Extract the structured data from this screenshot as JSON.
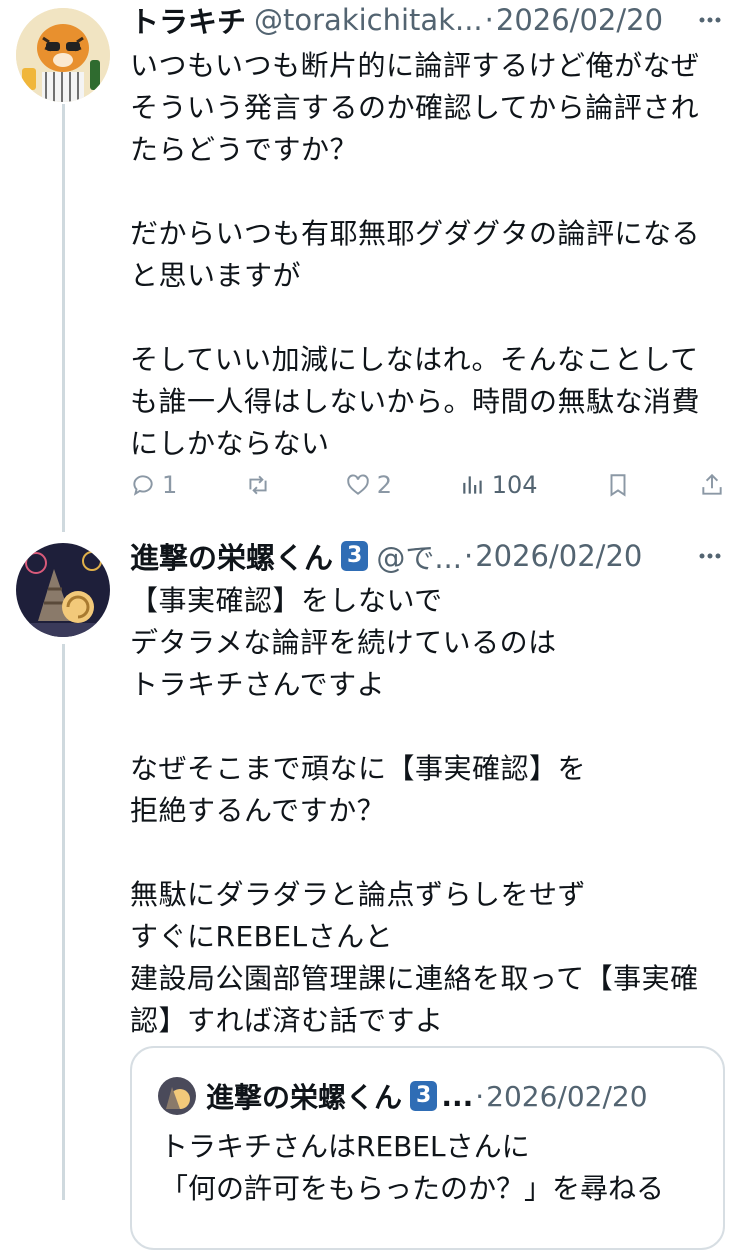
{
  "tweets": [
    {
      "name": "トラキチ",
      "handle": "@torakichitak...",
      "dot": "·",
      "date": "2026/02/20",
      "text": "いつもいつも断片的に論評するけど俺がなぜそういう発言するのか確認してから論評されたらどうですか？\n\nだからいつも有耶無耶グダグタの論評になると思いますが\n\nそしていい加減にしなはれ。そんなことしても誰一人得はしないから。時間の無駄な消費にしかならない",
      "replies": "1",
      "reposts": "",
      "likes": "2",
      "views": "104"
    },
    {
      "name": "進撃の栄螺くん",
      "badge": "3",
      "handle": "@で...",
      "dot": "·",
      "date": "2026/02/20",
      "text": "【事実確認】をしないで\nデタラメな論評を続けているのは\nトラキチさんですよ\n\nなぜそこまで頑なに【事実確認】を\n拒絶するんですか？\n\n無駄にダラダラと論点ずらしをせず\nすぐにREBELさんと\n建設局公園部管理課に連絡を取って【事実確認】すれば済む話ですよ",
      "quote": {
        "name": "進撃の栄螺くん",
        "badge": "3",
        "ellipsis": "...",
        "dot": "·",
        "date": "2026/02/20",
        "text": "トラキチさんはREBELさんに\n「何の許可をもらったのか？」を尋ねる"
      }
    }
  ],
  "colors": {
    "muted": "#536471",
    "line": "#cfd9de",
    "badge": "#2f6db5"
  }
}
